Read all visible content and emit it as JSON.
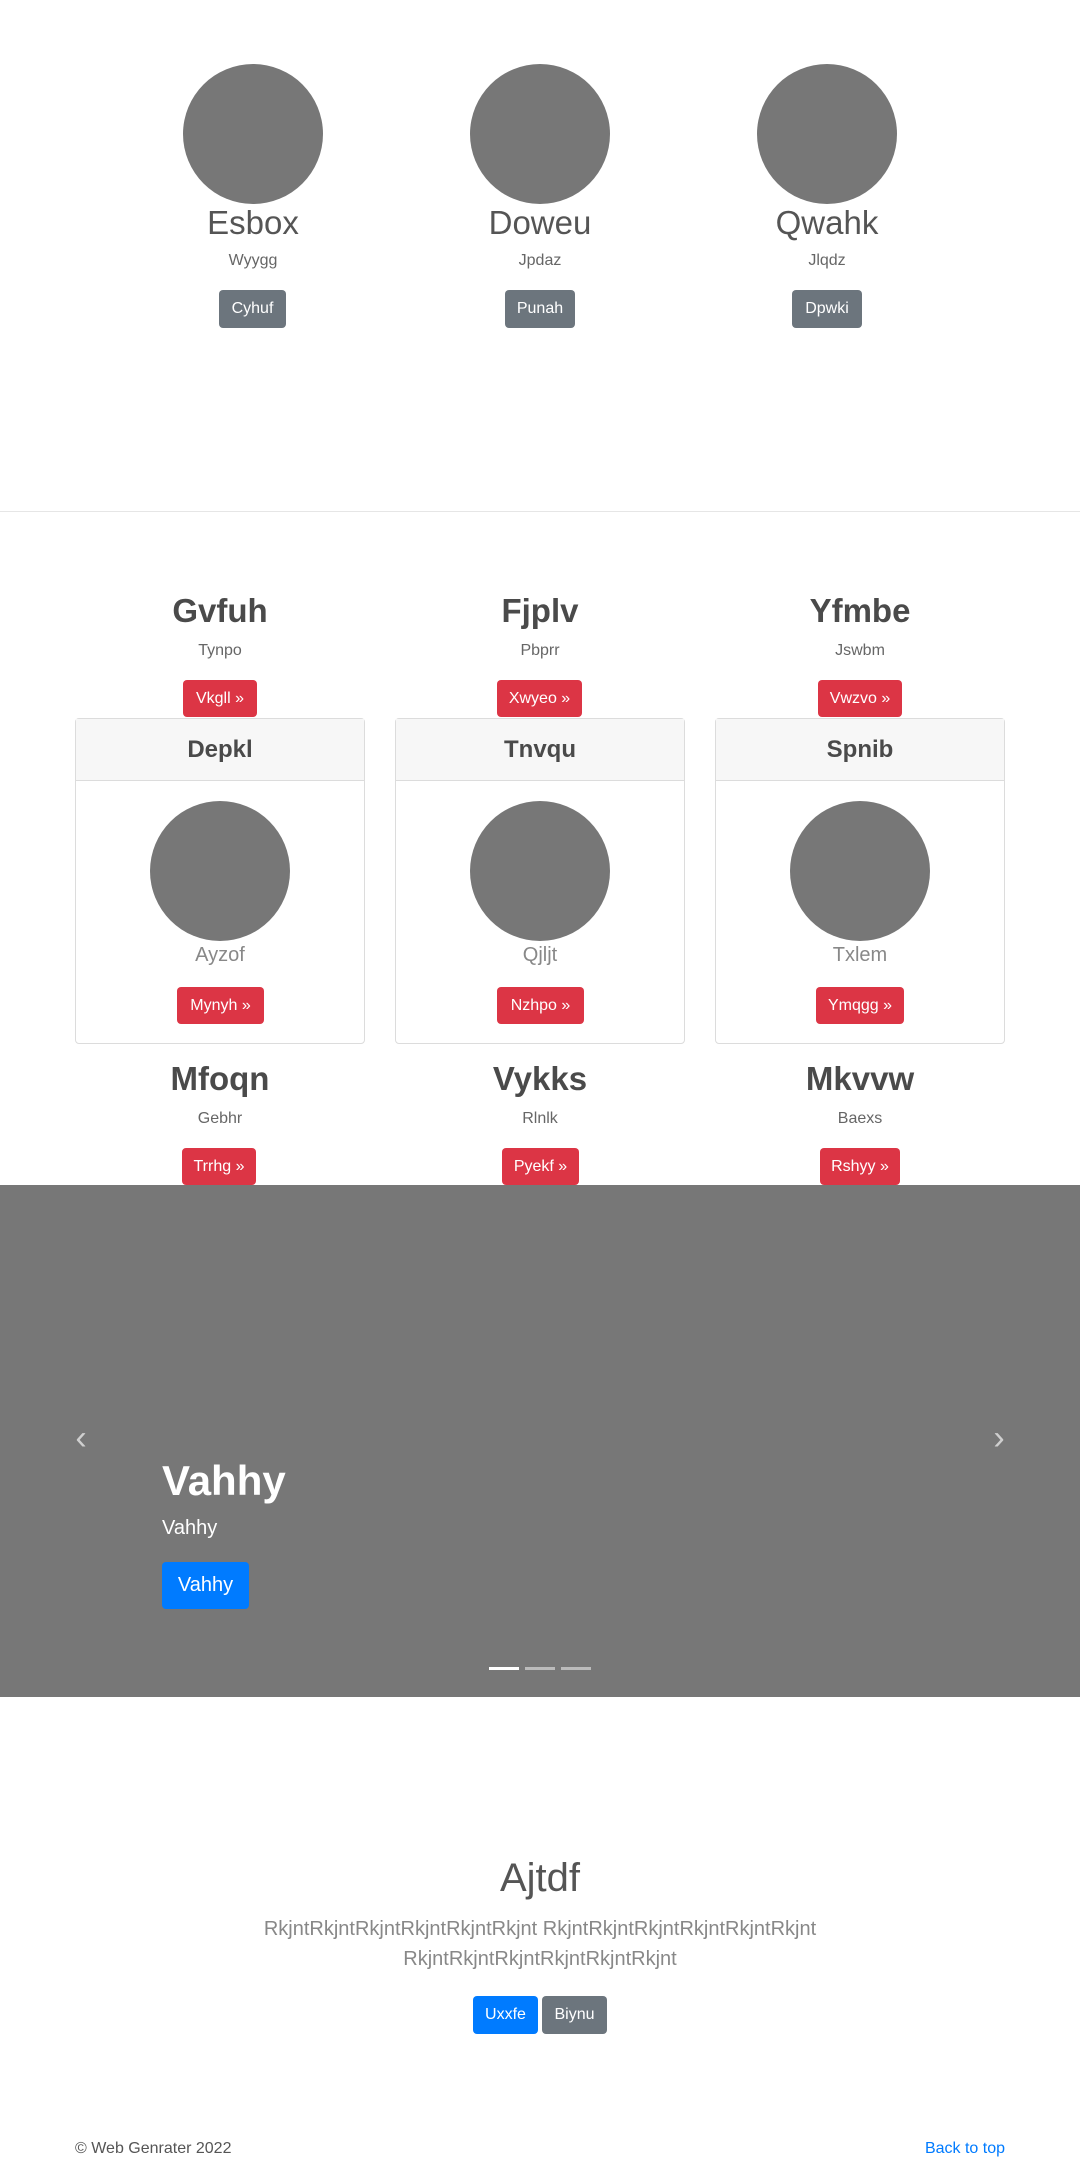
{
  "team": [
    {
      "name": "Esbox",
      "role": "Wyygg",
      "button": "Cyhuf"
    },
    {
      "name": "Doweu",
      "role": "Jpdaz",
      "button": "Punah"
    },
    {
      "name": "Qwahk",
      "role": "Jlqdz",
      "button": "Dpwki"
    }
  ],
  "features_top": [
    {
      "title": "Gvfuh",
      "subtitle": "Tynpo",
      "button": "Vkgll »"
    },
    {
      "title": "Fjplv",
      "subtitle": "Pbprr",
      "button": "Xwyeo »"
    },
    {
      "title": "Yfmbe",
      "subtitle": "Jswbm",
      "button": "Vwzvo »"
    }
  ],
  "cards": [
    {
      "header": "Depkl",
      "caption": "Ayzof",
      "button": "Mynyh »"
    },
    {
      "header": "Tnvqu",
      "caption": "Qjljt",
      "button": "Nzhpo »"
    },
    {
      "header": "Spnib",
      "caption": "Txlem",
      "button": "Ymqgg »"
    }
  ],
  "features_bottom": [
    {
      "title": "Mfoqn",
      "subtitle": "Gebhr",
      "button": "Trrhg »"
    },
    {
      "title": "Vykks",
      "subtitle": "Rlnlk",
      "button": "Pyekf »"
    },
    {
      "title": "Mkvvw",
      "subtitle": "Baexs",
      "button": "Rshyy »"
    }
  ],
  "carousel": {
    "title": "Vahhy",
    "subtitle": "Vahhy",
    "button": "Vahhy",
    "prev_icon": "‹",
    "next_icon": "›",
    "slide_count": 3,
    "active_slide": 1
  },
  "jumbotron": {
    "title": "Ajtdf",
    "lead": "RkjntRkjntRkjntRkjntRkjntRkjnt RkjntRkjntRkjntRkjntRkjntRkjnt RkjntRkjntRkjntRkjntRkjntRkjnt",
    "primary_button": "Uxxfe",
    "secondary_button": "Biynu"
  },
  "footer": {
    "copyright": "© Web Genrater 2022",
    "back_to_top": "Back to top"
  }
}
